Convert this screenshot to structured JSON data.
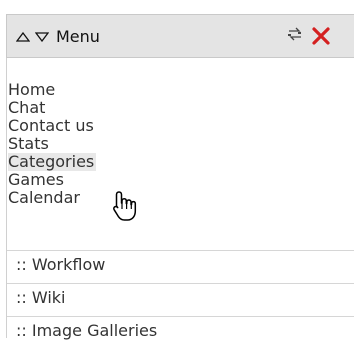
{
  "menu": {
    "title": "Menu",
    "links": [
      {
        "label": "Home"
      },
      {
        "label": "Chat"
      },
      {
        "label": "Contact us"
      },
      {
        "label": "Stats"
      },
      {
        "label": "Categories"
      },
      {
        "label": "Games"
      },
      {
        "label": "Calendar"
      }
    ],
    "sections": [
      {
        "label": ":: Workflow"
      },
      {
        "label": ":: Wiki"
      },
      {
        "label": ":: Image Galleries"
      }
    ]
  },
  "colors": {
    "header_bg": "#e4e4e4",
    "close_icon": "#d42020",
    "hover_bg": "#e8e8e8"
  },
  "icons": {
    "expand": "triangle-up-icon",
    "collapse": "triangle-down-icon",
    "settings": "settings-icon",
    "close": "close-icon",
    "cursor": "hand-cursor-icon"
  }
}
